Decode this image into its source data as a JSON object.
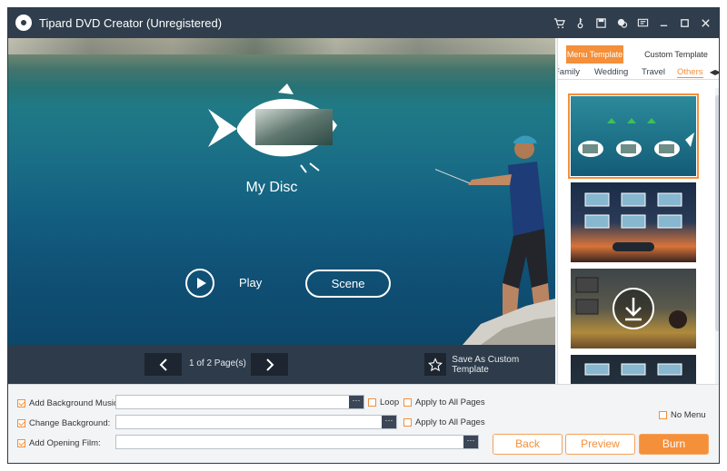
{
  "window": {
    "title": "Tipard DVD Creator (Unregistered)"
  },
  "title_icons": [
    "cart-icon",
    "key-icon",
    "save-icon",
    "chat-icon",
    "feedback-icon",
    "minimize-icon",
    "maximize-icon",
    "close-icon"
  ],
  "preview": {
    "disc_title": "My Disc",
    "play_label": "Play",
    "scene_label": "Scene"
  },
  "pager": {
    "page_label": "1 of 2 Page(s)",
    "save_custom_label": "Save As Custom Template"
  },
  "template_panel": {
    "tabs": [
      "Menu Template",
      "Custom Template"
    ],
    "active_tab": "Menu Template",
    "categories": [
      "Family",
      "Wedding",
      "Travel",
      "Others"
    ],
    "active_category": "Others"
  },
  "options": {
    "bg_music": {
      "label": "Add Background Music:",
      "checked": true,
      "value": ""
    },
    "loop_label": "Loop",
    "apply_all_label": "Apply to All Pages",
    "change_bg": {
      "label": "Change Background:",
      "checked": true,
      "value": ""
    },
    "opening_film": {
      "label": "Add Opening Film:",
      "checked": true,
      "value": ""
    },
    "no_menu_label": "No Menu",
    "browse_label": "···"
  },
  "buttons": {
    "back": "Back",
    "preview": "Preview",
    "burn": "Burn"
  },
  "colors": {
    "accent": "#f48f3a",
    "titlebar": "#2f3d4c",
    "pager": "#2e3b4a"
  }
}
